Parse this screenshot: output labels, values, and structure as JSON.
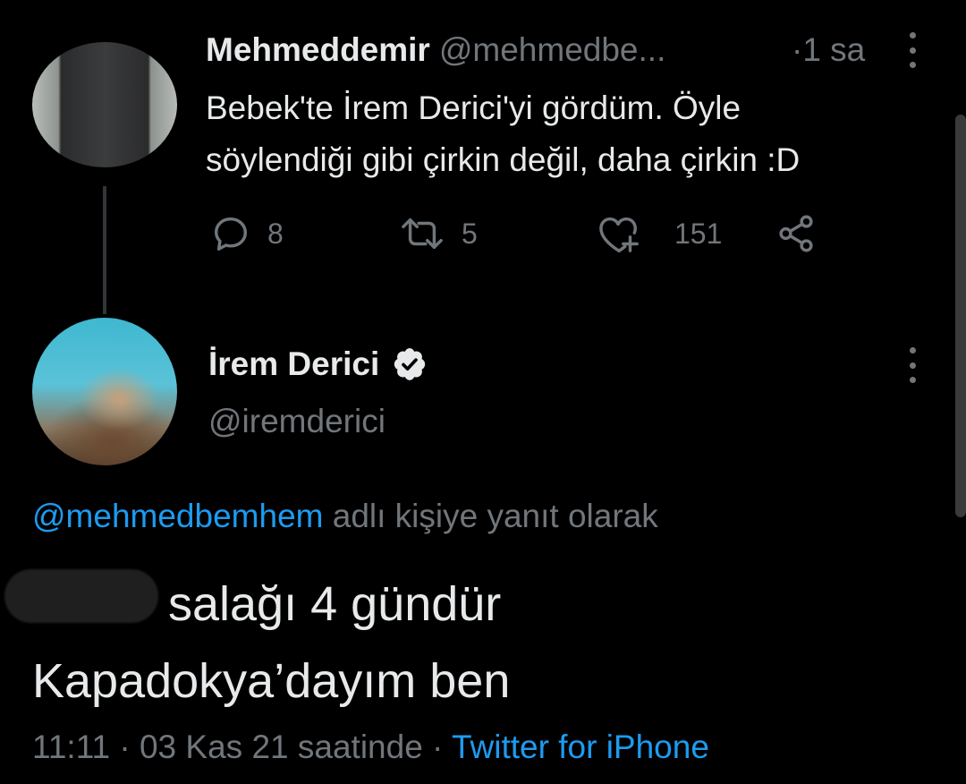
{
  "tweet1": {
    "display_name": "Mehmeddemir",
    "handle": "@mehmedbe...",
    "time": "·1 sa",
    "text_line1": "Bebek'te İrem Derici'yi gördüm. Öyle",
    "text_line2": "söylendiği gibi çirkin değil, daha çirkin :D",
    "reply_count": "8",
    "retweet_count": "5",
    "like_count": "151"
  },
  "tweet2": {
    "display_name": "İrem Derici",
    "handle": "@iremderici",
    "reply_to_handle": "@mehmedbemhem",
    "reply_to_suffix": " adlı kişiye yanıt olarak",
    "text_line1": "salağı 4 gündür",
    "text_line2": "Kapadokya’dayım ben",
    "timestamp": "11:11 · 03 Kas 21 saatinde · ",
    "source": "Twitter for iPhone"
  },
  "colors": {
    "background": "#000000",
    "text_primary": "#e7e9ea",
    "text_secondary": "#71767b",
    "link": "#1d9bf0"
  },
  "icons": [
    "more-icon",
    "reply-icon",
    "retweet-icon",
    "like-icon",
    "share-icon",
    "verified-icon"
  ]
}
